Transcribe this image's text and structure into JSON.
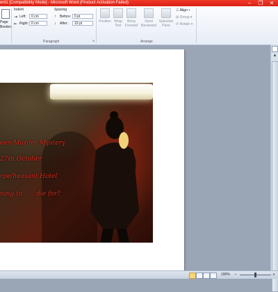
{
  "window": {
    "title": "ent1 [Compatibility Mode] - Microsoft Word (Product Activation Failed)",
    "minimize": "–",
    "restore": "❐",
    "close": "✕"
  },
  "ribbon": {
    "left_partial": {
      "page_borders_line1": "Page",
      "page_borders_line2": "Borders"
    },
    "paragraph": {
      "indent_label": "Indent",
      "spacing_label": "Spacing",
      "left_label": "Left:",
      "left_value": "0 cm",
      "right_label": "Right:",
      "right_value": "0 cm",
      "before_label": "Before:",
      "before_value": "0 pt",
      "after_label": "After:",
      "after_value": "10 pt",
      "group_label": "Paragraph"
    },
    "arrange": {
      "position": "Position",
      "wrap_text_1": "Wrap",
      "wrap_text_2": "Text",
      "bring_forward_1": "Bring",
      "bring_forward_2": "Forward",
      "send_backward_1": "Send",
      "send_backward_2": "Backward",
      "selection_pane_1": "Selection",
      "selection_pane_2": "Pane",
      "align": "Align",
      "group": "Group",
      "rotate": "Rotate",
      "group_label": "Arrange"
    }
  },
  "document": {
    "line1": "een Murder Mystery",
    "line2": "27th October",
    "line3": "rpe/heasant Hotel",
    "line4": "ning to . . . die for?"
  },
  "statusbar": {
    "zoom": "100%",
    "minus": "−",
    "plus": "+"
  },
  "colors": {
    "title_bar": "#e0251a",
    "invite_text": "#d8281c"
  }
}
